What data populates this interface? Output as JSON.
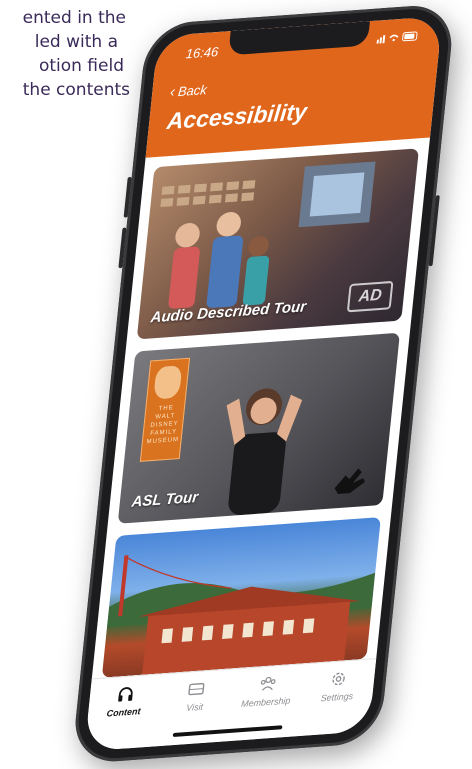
{
  "caption": {
    "lines": [
      "ented in the",
      "led with a",
      "otion field",
      "the contents"
    ]
  },
  "status": {
    "time": "16:46",
    "icons": "signal wifi battery"
  },
  "nav": {
    "back_label": "Back",
    "title": "Accessibility"
  },
  "cards": [
    {
      "label": "Audio Described Tour",
      "badge": "AD"
    },
    {
      "label": "ASL Tour",
      "logo": [
        "THE WALT",
        "DISNEY",
        "FAMILY",
        "MUSEUM"
      ]
    },
    {
      "label": ""
    }
  ],
  "tabs": [
    {
      "label": "Content",
      "icon": "headphones-icon",
      "active": true
    },
    {
      "label": "Visit",
      "icon": "ticket-icon",
      "active": false
    },
    {
      "label": "Membership",
      "icon": "people-icon",
      "active": false
    },
    {
      "label": "Settings",
      "icon": "gear-icon",
      "active": false
    }
  ],
  "colors": {
    "accent": "#e0661c",
    "tab_inactive": "#8e8e93"
  }
}
